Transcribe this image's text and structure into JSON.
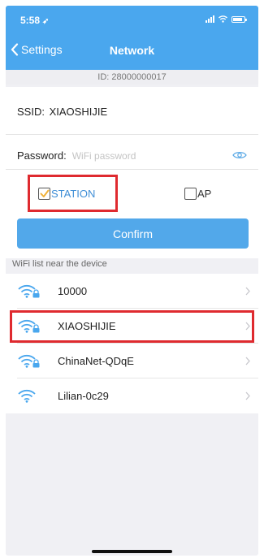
{
  "status": {
    "time": "5:58"
  },
  "nav": {
    "back_label": "Settings",
    "title": "Network"
  },
  "device": {
    "id_text": "ID: 28000000017"
  },
  "form": {
    "ssid_label": "SSID:",
    "ssid_value": "XIAOSHIJIE",
    "password_label": "Password:",
    "password_placeholder": "WiFi password",
    "password_value": "",
    "modes": [
      {
        "label": "STATION",
        "checked": true
      },
      {
        "label": "AP",
        "checked": false
      }
    ],
    "confirm_label": "Confirm"
  },
  "wifi_list": {
    "header": "WiFi list near the device",
    "items": [
      {
        "name": "10000",
        "locked": true
      },
      {
        "name": "XIAOSHIJIE",
        "locked": true
      },
      {
        "name": "ChinaNet-QDqE",
        "locked": true
      },
      {
        "name": "Lilian-0c29",
        "locked": false
      }
    ]
  },
  "colors": {
    "header": "#4aa7ee",
    "button": "#52a8ea",
    "highlight": "#df2a2f",
    "check": "#f0b23a"
  }
}
